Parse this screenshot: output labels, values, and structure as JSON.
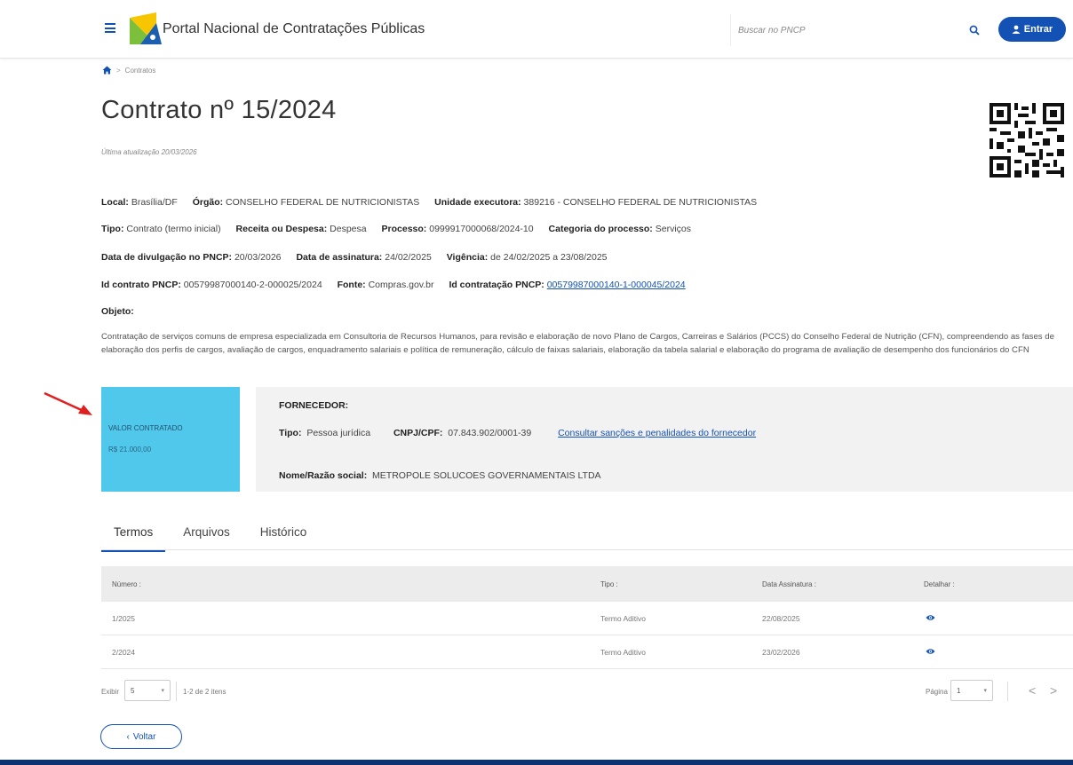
{
  "header": {
    "portal_title": "Portal Nacional de Contratações Públicas",
    "search_placeholder": "Buscar no PNCP",
    "login_label": "Entrar"
  },
  "breadcrumb": {
    "current": "Contratos",
    "separator": ">"
  },
  "page": {
    "title": "Contrato nº 15/2024",
    "last_updated": "Última atualização 20/03/2026"
  },
  "details": {
    "local": {
      "label": "Local:",
      "value": "Brasília/DF"
    },
    "orgao": {
      "label": "Órgão:",
      "value": "CONSELHO FEDERAL DE NUTRICIONISTAS"
    },
    "unidade": {
      "label": "Unidade executora:",
      "value": "389216 - CONSELHO FEDERAL DE NUTRICIONISTAS"
    },
    "tipo": {
      "label": "Tipo:",
      "value": "Contrato (termo inicial)"
    },
    "receita": {
      "label": "Receita ou Despesa:",
      "value": "Despesa"
    },
    "processo": {
      "label": "Processo:",
      "value": "0999917000068/2024-10"
    },
    "categoria": {
      "label": "Categoria do processo:",
      "value": "Serviços"
    },
    "data_divulgacao": {
      "label": "Data de divulgação no PNCP:",
      "value": "20/03/2026"
    },
    "data_assinatura": {
      "label": "Data de assinatura:",
      "value": "24/02/2025"
    },
    "vigencia": {
      "label": "Vigência:",
      "value": "de 24/02/2025 a 23/08/2025"
    },
    "id_contrato": {
      "label": "Id contrato PNCP:",
      "value": "00579987000140-2-000025/2024"
    },
    "fonte": {
      "label": "Fonte:",
      "value": "Compras.gov.br"
    },
    "id_contratacao": {
      "label": "Id contratação PNCP:",
      "value": "00579987000140-1-000045/2024"
    }
  },
  "objeto": {
    "label": "Objeto:",
    "text": "Contratação de serviços comuns de empresa especializada em Consultoria de Recursos Humanos, para revisão e elaboração de novo Plano de Cargos, Carreiras e Salários (PCCS) do Conselho Federal de Nutrição (CFN), compreendendo as fases de elaboração dos perfis de cargos, avaliação de cargos, enquadramento salariais e política de remuneração, cálculo de faixas salariais, elaboração da tabela salarial e elaboração do programa de avaliação de desempenho dos funcionários do CFN"
  },
  "valor": {
    "label": "VALOR CONTRATADO",
    "value": "R$ 21.000,00"
  },
  "fornecedor": {
    "title": "FORNECEDOR:",
    "tipo_label": "Tipo:",
    "tipo_value": "Pessoa jurídica",
    "cnpj_label": "CNPJ/CPF:",
    "cnpj_value": "07.843.902/0001-39",
    "sancoes_link": "Consultar sanções e penalidades do fornecedor",
    "nome_label": "Nome/Razão social:",
    "nome_value": "METROPOLE SOLUCOES GOVERNAMENTAIS LTDA"
  },
  "tabs": [
    {
      "label": "Termos",
      "active": true
    },
    {
      "label": "Arquivos",
      "active": false
    },
    {
      "label": "Histórico",
      "active": false
    }
  ],
  "table": {
    "columns": [
      "Número :",
      "Tipo :",
      "Data Assinatura :",
      "Detalhar :"
    ],
    "rows": [
      {
        "numero": "1/2025",
        "tipo": "Termo Aditivo",
        "data": "22/08/2025"
      },
      {
        "numero": "2/2024",
        "tipo": "Termo Aditivo",
        "data": "23/02/2026"
      }
    ]
  },
  "pagination": {
    "exibir_label": "Exibir",
    "page_size": "5",
    "items_count": "1-2 de 2 itens",
    "pagina_label": "Página",
    "page": "1",
    "prev": "<",
    "next": ">"
  },
  "voltar_label": "Voltar",
  "colors": {
    "primary": "#1351b4",
    "valor_bg": "#4fc8ec",
    "annotation_arrow": "#e02020",
    "footer": "#0c326f"
  }
}
